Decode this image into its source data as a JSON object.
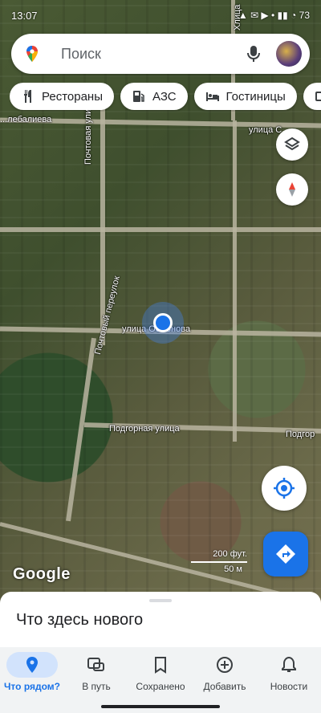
{
  "status": {
    "time": "13:07",
    "system": "▲ ✉ ▶  •   ▮▮ ◔ 73"
  },
  "search": {
    "placeholder": "Поиск"
  },
  "chips": [
    {
      "label": "Рестораны",
      "icon": "restaurant-icon"
    },
    {
      "label": "АЗС",
      "icon": "gas-station-icon"
    },
    {
      "label": "Гостиницы",
      "icon": "hotel-icon"
    },
    {
      "label": "",
      "icon": "coffee-icon"
    }
  ],
  "map": {
    "streets": {
      "chelebalieva": "...лебалиева",
      "pochtovaya": "Почтовая улица",
      "pochtovy_pereulok": "Почтовый переулок",
      "osmonova": "улица Осмонова",
      "podgornaya": "Подгорная улица",
      "podgor_right": "Подгор",
      "ulitsa_right": "улица С",
      "top_right": "Хлица"
    },
    "scale": {
      "imperial": "200 фут.",
      "metric": "50 м"
    },
    "attribution": "Google"
  },
  "sheet": {
    "title": "Что здесь нового"
  },
  "nav": [
    {
      "label": "Что рядом?",
      "icon": "location-pin-icon",
      "active": true
    },
    {
      "label": "В путь",
      "icon": "commute-icon",
      "active": false
    },
    {
      "label": "Сохранено",
      "icon": "bookmark-icon",
      "active": false
    },
    {
      "label": "Добавить",
      "icon": "add-circle-icon",
      "active": false
    },
    {
      "label": "Новости",
      "icon": "bell-icon",
      "active": false
    }
  ],
  "colors": {
    "accent": "#1a73e8",
    "active_tab_bg": "#d2e3fc"
  }
}
